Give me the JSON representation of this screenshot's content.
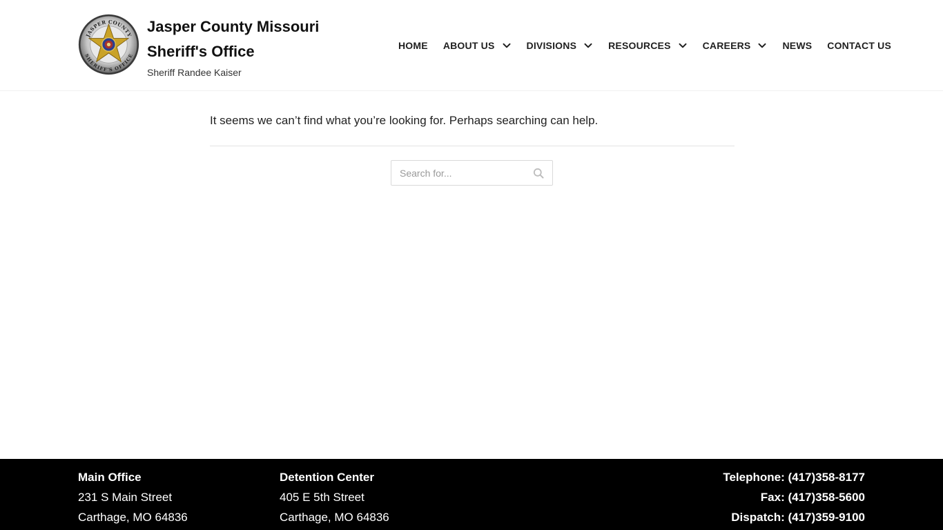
{
  "site": {
    "title": "Jasper County Missouri Sheriff's Office",
    "tagline": "Sheriff Randee Kaiser",
    "seal_text_top": "JASPER COUNTY",
    "seal_text_bottom": "SHERIFF'S OFFICE"
  },
  "nav": {
    "items": [
      {
        "label": "HOME",
        "has_dropdown": false
      },
      {
        "label": "ABOUT US",
        "has_dropdown": true
      },
      {
        "label": "DIVISIONS",
        "has_dropdown": true
      },
      {
        "label": "RESOURCES",
        "has_dropdown": true
      },
      {
        "label": "CAREERS",
        "has_dropdown": true
      },
      {
        "label": "NEWS",
        "has_dropdown": false
      },
      {
        "label": "CONTACT US",
        "has_dropdown": false
      }
    ]
  },
  "main": {
    "notice": "It seems we can’t find what you’re looking for. Perhaps searching can help.",
    "search": {
      "value": "",
      "placeholder": "Search for...",
      "icon": "search-icon"
    }
  },
  "footer": {
    "main_office": {
      "heading": "Main Office",
      "line1": "231 S Main Street",
      "line2": "Carthage, MO 64836"
    },
    "detention_center": {
      "heading": "Detention Center",
      "line1": "405 E 5th Street",
      "line2": "Carthage, MO 64836"
    },
    "contact": {
      "telephone": "Telephone: (417)358-8177",
      "fax": "Fax: (417)358-5600",
      "dispatch": "Dispatch: (417)359-9100"
    }
  },
  "colors": {
    "footer_bg": "#000000",
    "text": "#1d1d1d",
    "accent": "#c9a227"
  }
}
